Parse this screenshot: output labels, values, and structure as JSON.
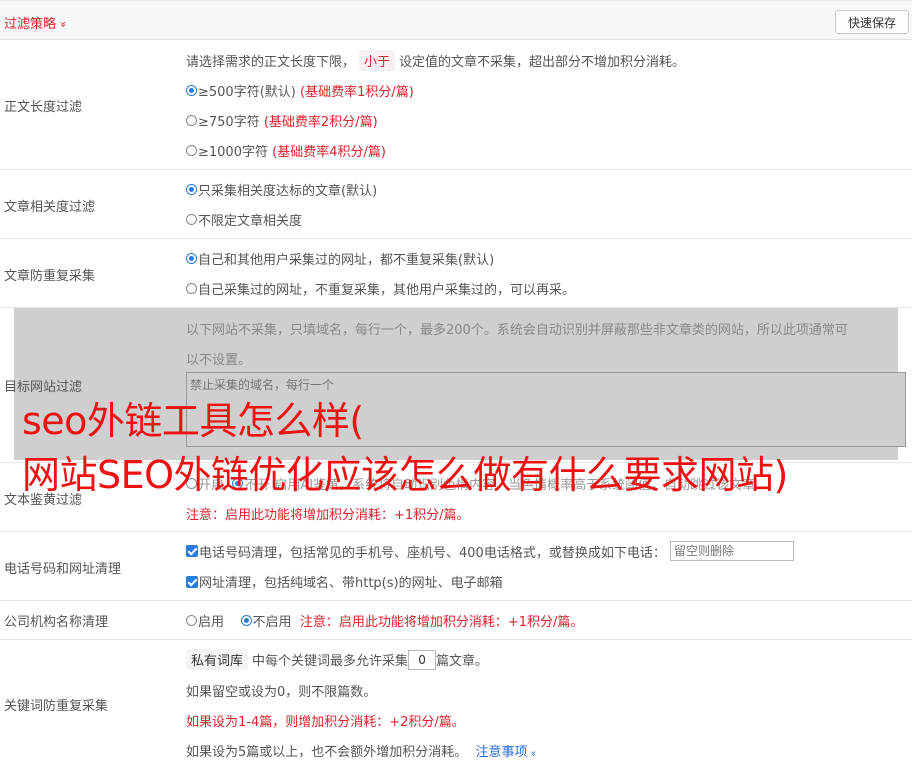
{
  "header": {
    "title": "过滤策略",
    "chevron": "»",
    "save_label": "快速保存"
  },
  "length_filter": {
    "label": "正文长度过滤",
    "desc_before": "请选择需求的正文长度下限，",
    "desc_pill": "小于",
    "desc_after": "设定值的文章不采集，超出部分不增加积分消耗。",
    "options": [
      {
        "text": "≥500字符(默认)",
        "note": "(基础费率1积分/篇)",
        "selected": true
      },
      {
        "text": "≥750字符",
        "note": "(基础费率2积分/篇)",
        "selected": false
      },
      {
        "text": "≥1000字符",
        "note": "(基础费率4积分/篇)",
        "selected": false
      }
    ]
  },
  "relevance_filter": {
    "label": "文章相关度过滤",
    "options": [
      {
        "text": "只采集相关度达标的文章(默认)",
        "selected": true
      },
      {
        "text": "不限定文章相关度",
        "selected": false
      }
    ]
  },
  "dedupe": {
    "label": "文章防重复采集",
    "options": [
      {
        "text": "自己和其他用户采集过的网址，都不重复采集(默认)",
        "selected": true
      },
      {
        "text": "自己采集过的网址，不重复采集，其他用户采集过的，可以再采。",
        "selected": false
      }
    ]
  },
  "target_sites": {
    "label": "目标网站过滤",
    "desc_line1": "以下网站不采集，只填域名，每行一个，最多200个。系统会自动识别并屏蔽那些非文章类的网站，所以此项通常可",
    "desc_line2": "以不设置。",
    "placeholder": "禁止采集的域名，每行一个"
  },
  "porn_filter": {
    "label": "文本鉴黄过滤",
    "opt1": "开启",
    "opt2_partial": "不开   启用AI鉴黄，系统将自动识别色情内容，当色情概率高于系统阈值，自动跳过该文章",
    "notice": "注意：启用此功能将增加积分消耗：+1积分/篇。"
  },
  "phone_url": {
    "label": "电话号码和网址清理",
    "phone_text": "电话号码清理，包括常见的手机号、座机号、400电话格式，或替换成如下电话：",
    "phone_placeholder": "留空则删除",
    "url_text": "网址清理，包括纯域名、带http(s)的网址、电子邮箱"
  },
  "company": {
    "label": "公司机构名称清理",
    "opt_on": "启用",
    "opt_off": "不启用",
    "notice": "注意：启用此功能将增加积分消耗：+1积分/篇。"
  },
  "keyword_dedupe": {
    "label": "关键词防重复采集",
    "pill": "私有词库",
    "line1_a": "中每个关键词最多允许采集",
    "value": "0",
    "line1_b": "篇文章。",
    "line2": "如果留空或设为0，则不限篇数。",
    "line3": "如果设为1-4篇，则增加积分消耗：+2积分/篇。",
    "line4": "如果设为5篇或以上，也不会额外增加积分消耗。",
    "link": "注意事项",
    "link_chevron": "»"
  },
  "watermark": {
    "line1": "seo外链工具怎么样(",
    "line2": "网站SEO外链优化应该怎么做有什么要求网站)"
  }
}
